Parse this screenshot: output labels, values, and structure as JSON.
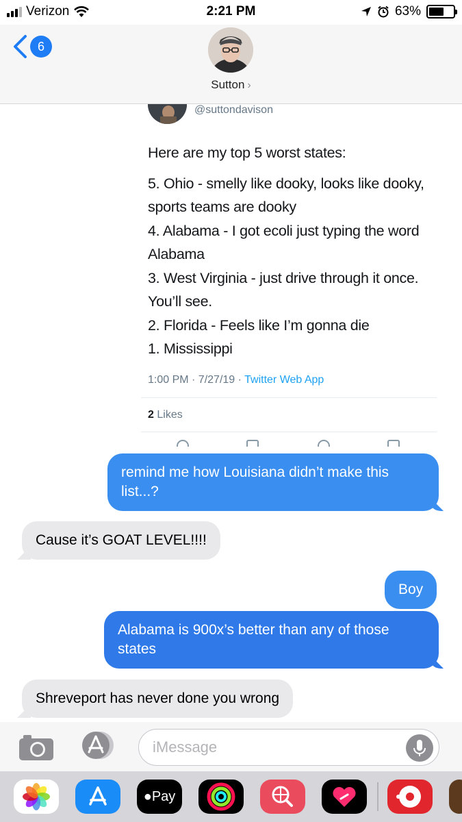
{
  "status_bar": {
    "carrier": "Verizon",
    "time": "2:21 PM",
    "battery_percent": "63%",
    "battery_level": 0.63,
    "icons": [
      "signal-icon",
      "wifi-icon",
      "location-icon",
      "alarm-icon",
      "battery-icon"
    ]
  },
  "header": {
    "unread_count": "6",
    "contact_name": "Sutton",
    "contact_chevron": "›"
  },
  "tweet": {
    "handle": "@suttondavison",
    "intro": "Here are my top 5 worst states:",
    "lines": [
      "5. Ohio - smelly like dooky, looks like dooky, sports teams are dooky",
      "4. Alabama - I got ecoli just typing the word Alabama",
      "3. West Virginia - just drive through it once. You’ll see.",
      "2. Florida - Feels like I’m gonna die",
      "1. Mississippi"
    ],
    "timestamp": "1:00 PM · 7/27/19 · ",
    "source": "Twitter Web App",
    "likes_count": "2",
    "likes_label": "Likes"
  },
  "messages": [
    {
      "from": "me",
      "text": "remind me how Louisiana didn’t make this list...?"
    },
    {
      "from": "them",
      "text": "Cause it’s GOAT LEVEL!!!!"
    },
    {
      "from": "me",
      "text": "Boy"
    },
    {
      "from": "me",
      "text": "Alabama is 900x’s better than any of those states"
    },
    {
      "from": "them",
      "text": "Shreveport has never done you wrong"
    }
  ],
  "input": {
    "placeholder": "iMessage"
  },
  "app_drawer": {
    "apps": [
      {
        "icon": "photos-icon"
      },
      {
        "icon": "app-store-icon"
      },
      {
        "icon": "apple-pay-icon",
        "label": "Pay"
      },
      {
        "icon": "activity-icon"
      },
      {
        "icon": "web-search-icon"
      },
      {
        "icon": "digital-touch-icon"
      },
      {
        "icon": "music-icon"
      },
      {
        "icon": "extra-app-icon"
      }
    ]
  },
  "colors": {
    "sent_bubble": "#3a8ef0",
    "received_bubble": "#e9e9eb",
    "ios_blue": "#1e7cf5",
    "twitter_link": "#1da1f2"
  }
}
